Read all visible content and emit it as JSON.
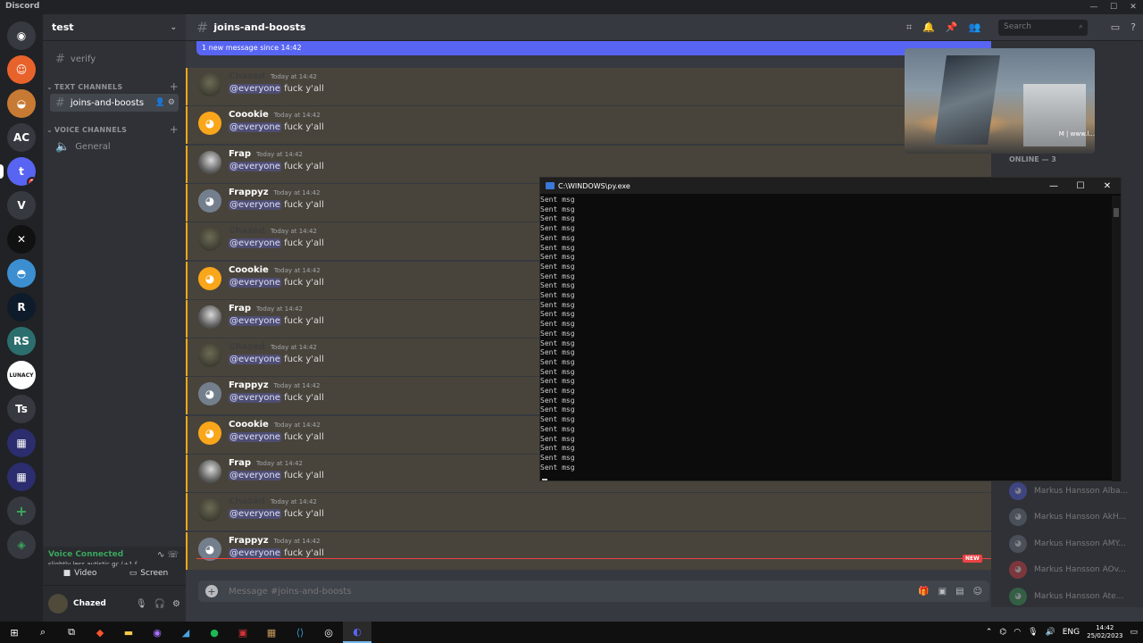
{
  "app": {
    "title": "Discord"
  },
  "server": {
    "name": "test"
  },
  "rail": {
    "servers": [
      {
        "label": "",
        "icon": "discord-home-icon",
        "color": "#36393f"
      },
      {
        "label": "",
        "icon": "friend-avatar",
        "color": "#e8632b"
      },
      {
        "label": "",
        "icon": "cheese-server-icon",
        "color": "#c77a33"
      },
      {
        "label": "AC",
        "icon": "",
        "color": "#36393f"
      },
      {
        "label": "t",
        "icon": "",
        "color": "#5865f2",
        "badge": "1"
      },
      {
        "label": "V",
        "icon": "",
        "color": "#36393f"
      },
      {
        "label": "",
        "icon": "x-logo-server-icon",
        "color": "#111111"
      },
      {
        "label": "",
        "icon": "blue-mascot-server-icon",
        "color": "#3b8fd1"
      },
      {
        "label": "R",
        "icon": "",
        "color": "#0d1b2a"
      },
      {
        "label": "RS",
        "icon": "",
        "color": "#2c6e6e"
      },
      {
        "label": "LUNACY",
        "icon": "",
        "color": "#ffffff"
      },
      {
        "label": "Ts",
        "icon": "",
        "color": "#36393f"
      },
      {
        "label": "",
        "icon": "folder-server-icon",
        "color": "#2b2d6e"
      },
      {
        "label": "",
        "icon": "folder-server-icon-2",
        "color": "#2b2d6e"
      },
      {
        "label": "+",
        "icon": "add-server-icon",
        "color": "#36393f"
      },
      {
        "label": "",
        "icon": "explore-icon",
        "color": "#36393f"
      }
    ]
  },
  "sidebar": {
    "verify": "verify",
    "text_category": "TEXT CHANNELS",
    "active_channel": "joins-and-boosts",
    "voice_category": "VOICE CHANNELS",
    "voice_channel": "General"
  },
  "voice": {
    "status": "Voice Connected",
    "subtitle": "slightly less autistic gc (+1 f...",
    "video_label": "Video",
    "screen_label": "Screen"
  },
  "user": {
    "name": "Chazed"
  },
  "header": {
    "channel": "joins-and-boosts",
    "search_placeholder": "Search"
  },
  "banner": {
    "text": "1 new message since 14:42"
  },
  "messages": [
    {
      "author": "Chazed",
      "time": "Today at 14:42",
      "mention": "@everyone",
      "text": "fuck y'all",
      "color": "#3d3d3d",
      "avatar": "chazed"
    },
    {
      "author": "Coookie",
      "time": "Today at 14:42",
      "mention": "@everyone",
      "text": "fuck y'all",
      "color": "#ffffff",
      "avatar": "coookie"
    },
    {
      "author": "Frap",
      "time": "Today at 14:42",
      "mention": "@everyone",
      "text": "fuck y'all",
      "color": "#ffffff",
      "avatar": "frap"
    },
    {
      "author": "Frappyz",
      "time": "Today at 14:42",
      "mention": "@everyone",
      "text": "fuck y'all",
      "color": "#ffffff",
      "avatar": "frappyz"
    },
    {
      "author": "Chazed",
      "time": "Today at 14:42",
      "mention": "@everyone",
      "text": "fuck y'all",
      "color": "#3d3d3d",
      "avatar": "chazed"
    },
    {
      "author": "Coookie",
      "time": "Today at 14:42",
      "mention": "@everyone",
      "text": "fuck y'all",
      "color": "#ffffff",
      "avatar": "coookie"
    },
    {
      "author": "Frap",
      "time": "Today at 14:42",
      "mention": "@everyone",
      "text": "fuck y'all",
      "color": "#ffffff",
      "avatar": "frap"
    },
    {
      "author": "Chazed",
      "time": "Today at 14:42",
      "mention": "@everyone",
      "text": "fuck y'all",
      "color": "#3d3d3d",
      "avatar": "chazed"
    },
    {
      "author": "Frappyz",
      "time": "Today at 14:42",
      "mention": "@everyone",
      "text": "fuck y'all",
      "color": "#ffffff",
      "avatar": "frappyz"
    },
    {
      "author": "Coookie",
      "time": "Today at 14:42",
      "mention": "@everyone",
      "text": "fuck y'all",
      "color": "#ffffff",
      "avatar": "coookie"
    },
    {
      "author": "Frap",
      "time": "Today at 14:42",
      "mention": "@everyone",
      "text": "fuck y'all",
      "color": "#ffffff",
      "avatar": "frap"
    },
    {
      "author": "Chazed",
      "time": "Today at 14:42",
      "mention": "@everyone",
      "text": "fuck y'all",
      "color": "#3d3d3d",
      "avatar": "chazed"
    },
    {
      "author": "Frappyz",
      "time": "Today at 14:42",
      "mention": "@everyone",
      "text": "fuck y'all",
      "color": "#ffffff",
      "avatar": "frappyz"
    }
  ],
  "new_tag": "NEW",
  "composer": {
    "placeholder": "Message #joins-and-boosts"
  },
  "members": {
    "online_header": "ONLINE — 3",
    "offline": [
      "Markus Hansson Alba...",
      "Markus Hansson AkH...",
      "Markus Hansson AMY...",
      "Markus Hansson AOv...",
      "Markus Hansson Ate..."
    ],
    "offline_colors": [
      "#5865f2",
      "#747f8d",
      "#747f8d",
      "#ed4245",
      "#3ba55d"
    ]
  },
  "video_overlay": {
    "caption": "M | www.l..."
  },
  "console": {
    "title": "C:\\WINDOWS\\py.exe",
    "line": "Sent msg",
    "line_count": 29
  },
  "taskbar": {
    "lang": "ENG",
    "time": "14:42",
    "date": "25/02/2023"
  }
}
